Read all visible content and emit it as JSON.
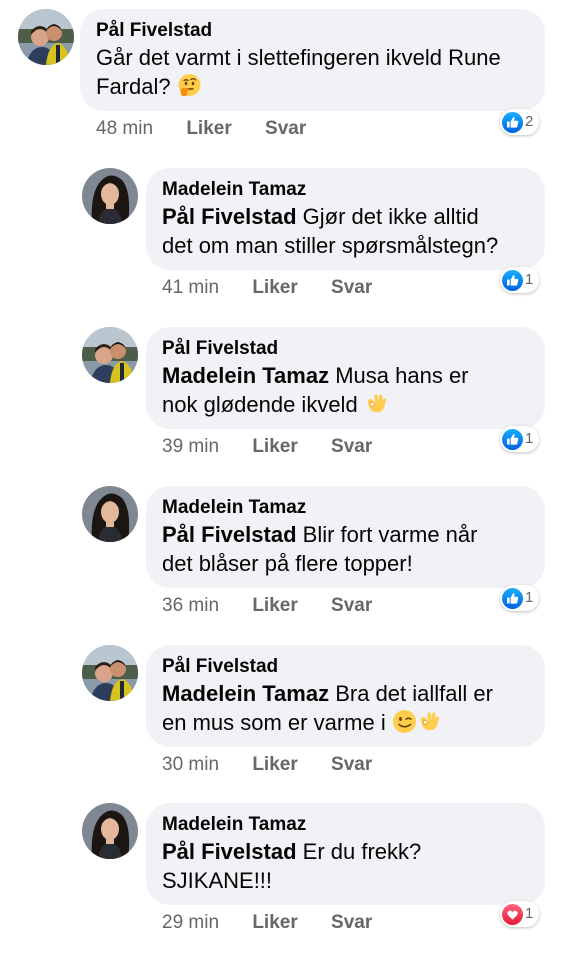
{
  "actions": {
    "like": "Liker",
    "reply": "Svar"
  },
  "colors": {
    "bubble": "#f0f2f5",
    "like_blue": "#1877f2",
    "love_red": "#f33e58",
    "meta_gray": "#65676b"
  },
  "comments": [
    {
      "author": "Pål Fivelstad",
      "avatar": "couple-photo",
      "mention": "",
      "text_lines": [
        "Går det varmt i slettefingeren ikveld Rune",
        "Fardal?"
      ],
      "emojis": [
        "thinking-face-emoji"
      ],
      "time": "48 min",
      "reaction": {
        "type": "like-icon",
        "count": "2"
      }
    },
    {
      "author": "Madelein Tamaz",
      "avatar": "woman-portrait",
      "mention": "Pål Fivelstad",
      "text_lines": [
        "Gjør det ikke alltid",
        "det om man stiller spørsmålstegn?"
      ],
      "emojis": [],
      "time": "41 min",
      "reaction": {
        "type": "like-icon",
        "count": "1"
      }
    },
    {
      "author": "Pål Fivelstad",
      "avatar": "couple-photo",
      "mention": "Madelein Tamaz",
      "text_lines": [
        "Musa hans er",
        "nok glødende ikveld"
      ],
      "emojis": [
        "ok-hand-emoji"
      ],
      "time": "39 min",
      "reaction": {
        "type": "like-icon",
        "count": "1"
      }
    },
    {
      "author": "Madelein Tamaz",
      "avatar": "woman-portrait",
      "mention": "Pål Fivelstad",
      "text_lines": [
        "Blir fort varme når",
        "det blåser på flere topper!"
      ],
      "emojis": [],
      "time": "36 min",
      "reaction": {
        "type": "like-icon",
        "count": "1"
      }
    },
    {
      "author": "Pål Fivelstad",
      "avatar": "couple-photo",
      "mention": "Madelein Tamaz",
      "text_lines": [
        "Bra det iallfall er",
        "en mus som er varme i"
      ],
      "emojis": [
        "winking-face-emoji",
        "ok-hand-emoji"
      ],
      "time": "30 min",
      "reaction": {
        "type": "like-icon",
        "count": "1"
      }
    },
    {
      "author": "Madelein Tamaz",
      "avatar": "woman-portrait",
      "mention": "Pål Fivelstad",
      "text_lines": [
        "Er du frekk?",
        "SJIKANE!!!"
      ],
      "emojis": [],
      "time": "29 min",
      "reaction": {
        "type": "love-icon",
        "count": "1"
      }
    }
  ]
}
